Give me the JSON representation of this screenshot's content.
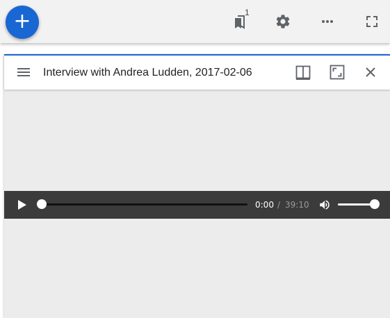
{
  "toolbar": {
    "add_label": "+",
    "bookmark_count": "1"
  },
  "window": {
    "title": "Interview with Andrea Ludden, 2017-02-06"
  },
  "player": {
    "current_time": "0:00",
    "separator": "/",
    "duration": "39:10",
    "progress": 0,
    "volume": 1.0
  },
  "colors": {
    "accent": "#1967d2",
    "toolbar_bg": "#f2f2f2",
    "panel_bg": "#ececec",
    "player_bg": "#3b3b3b",
    "icon": "#5f6368"
  },
  "icons": [
    "add-icon",
    "bookmark-stack-icon",
    "gear-icon",
    "more-horizontal-icon",
    "fullscreen-icon",
    "menu-icon",
    "split-view-icon",
    "maximize-icon",
    "close-icon",
    "play-icon",
    "volume-icon"
  ]
}
